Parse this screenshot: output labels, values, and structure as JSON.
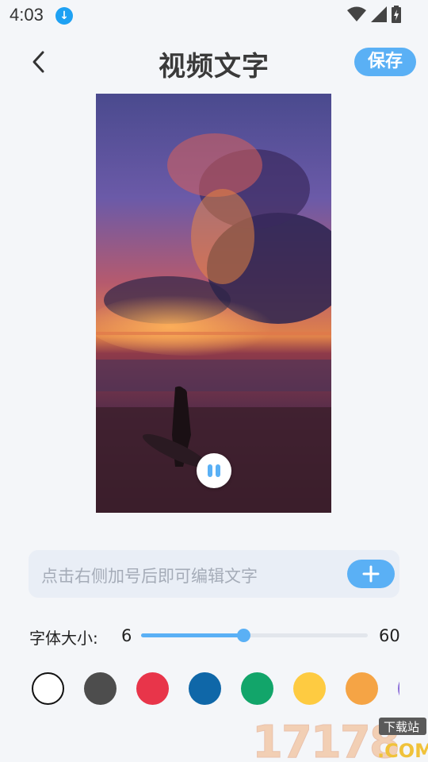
{
  "status_bar": {
    "time": "4:03"
  },
  "header": {
    "title": "视频文字",
    "save_label": "保存"
  },
  "text_input": {
    "placeholder": "点击右侧加号后即可编辑文字"
  },
  "font_size": {
    "label": "字体大小:",
    "min": "6",
    "max": "60",
    "value_fraction": 0.45
  },
  "colors": [
    "#ffffff",
    "#4d4d4d",
    "#e8354a",
    "#0f67a8",
    "#12a56a",
    "#fecb41",
    "#f5a445",
    "#8a6bd8"
  ],
  "watermark": {
    "text": "17178",
    "badge": "下载站",
    "suffix": ".COM"
  }
}
